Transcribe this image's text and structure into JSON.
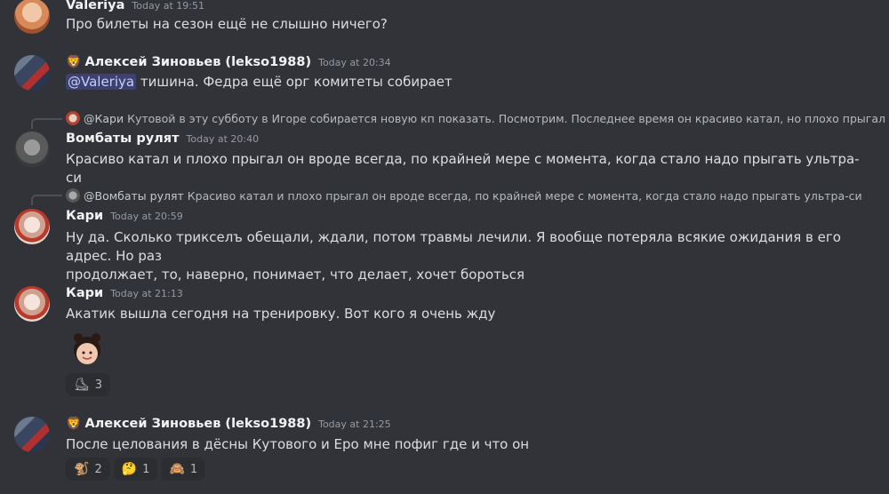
{
  "messages": [
    {
      "author": "Valeriya",
      "time": "Today at 19:51",
      "text": "Про билеты на сезон ещё не слышно ничего?"
    },
    {
      "author": "Алексей Зиновьев (lekso1988)",
      "prefix": "🦁",
      "time": "Today at 20:34",
      "mention": "@Valeriya",
      "text": " тишина. Федра ещё орг комитеты собирает"
    },
    {
      "reply_name": "@Кари",
      "reply_text": "Кутовой в эту субботу в Игоре собирается новую кп показать. Посмотрим. Последнее время он красиво катал, но плохо прыгал",
      "author": "Вомбаты рулят",
      "time": "Today at 20:40",
      "text": "Красиво катал и плохо прыгал он вроде всегда, по крайней мере с момента, когда стало надо прыгать ультра-си"
    },
    {
      "reply_name": "@Вомбаты рулят",
      "reply_text": "Красиво катал и плохо прыгал он вроде всегда, по крайней мере с момента, когда стало надо прыгать ультра-си",
      "author": "Кари",
      "time": "Today at 20:59",
      "text_line1": "Ну да. Сколько трикселъ обещали, ждали, потом травмы лечили. Я вообще потеряла всякие ожидания в его адрес. Но раз",
      "text_line2": "продолжает, то, наверно, понимает, что делает, хочет бороться"
    },
    {
      "author": "Кари",
      "time": "Today at 21:13",
      "text": "Акатик вышла сегодня на тренировку. Вот кого я очень жду",
      "reactions": [
        {
          "icon": "⛸",
          "count": "3"
        }
      ]
    },
    {
      "author": "Алексей Зиновьев (lekso1988)",
      "prefix": "🦁",
      "time": "Today at 21:25",
      "text": "После целования в дёсны Кутового и Еро мне пофиг где и что он",
      "reactions": [
        {
          "icon": "🐒",
          "count": "2"
        },
        {
          "icon": "🤔",
          "count": "1"
        },
        {
          "icon": "🙈",
          "count": "1"
        }
      ]
    }
  ],
  "colors": {
    "background": "#313338",
    "mention": "#5865f2"
  }
}
